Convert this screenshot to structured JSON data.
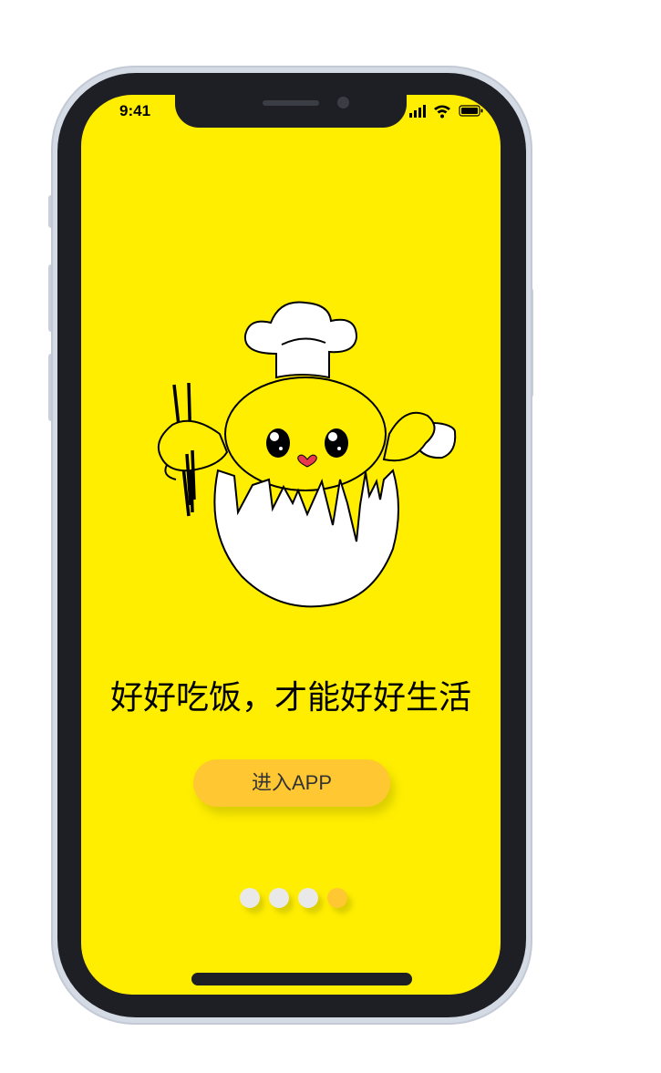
{
  "status_bar": {
    "time": "9:41",
    "signal_icon": "cellular-signal-icon",
    "wifi_icon": "wifi-icon",
    "battery_icon": "battery-icon"
  },
  "main": {
    "illustration": "chef-chick-in-eggshell-mascot",
    "slogan": "好好吃饭，才能好好生活",
    "enter_button_label": "进入APP"
  },
  "pagination": {
    "count": 4,
    "active_index": 3
  },
  "colors": {
    "screen_background": "#ffee00",
    "button_background": "#ffc832",
    "dot_inactive": "#e9e9ea",
    "dot_active": "#ffc832"
  }
}
